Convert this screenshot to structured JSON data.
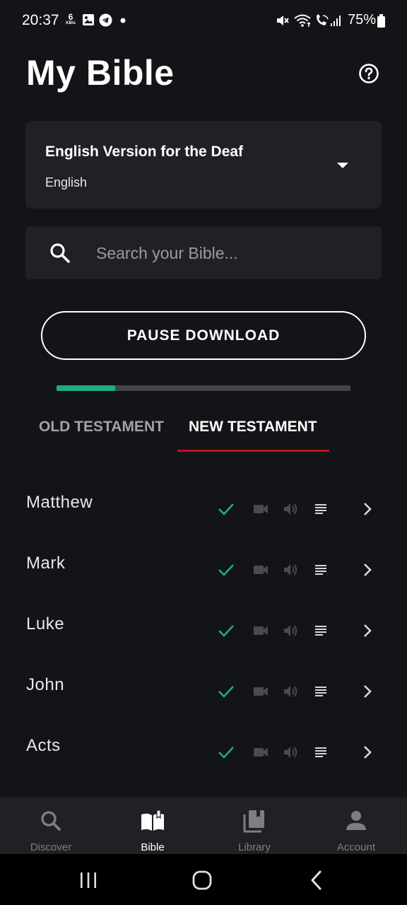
{
  "status_bar": {
    "time": "20:37",
    "net_speed_value": "6",
    "net_speed_unit": "KB/s",
    "battery": "75%",
    "icons": [
      "image-icon",
      "telegram-icon",
      "dot-icon",
      "mute-icon",
      "wifi-icon",
      "wifi-calling-icon",
      "signal-icon",
      "battery-icon"
    ]
  },
  "header": {
    "title": "My Bible",
    "help_icon": "help-circle-icon"
  },
  "version": {
    "name": "English Version for the Deaf",
    "language": "English",
    "dropdown_icon": "caret-down-icon"
  },
  "search": {
    "placeholder": "Search your Bible...",
    "value": ""
  },
  "download": {
    "button_label": "PAUSE DOWNLOAD",
    "progress_fraction": 0.2
  },
  "tabs": {
    "items": [
      "OLD TESTAMENT",
      "NEW TESTAMENT"
    ],
    "selected": "NEW TESTAMENT"
  },
  "books": [
    {
      "name": "Matthew",
      "downloaded": true,
      "video": false,
      "audio": false,
      "text": true
    },
    {
      "name": "Mark",
      "downloaded": true,
      "video": false,
      "audio": false,
      "text": true
    },
    {
      "name": "Luke",
      "downloaded": true,
      "video": false,
      "audio": false,
      "text": true
    },
    {
      "name": "John",
      "downloaded": true,
      "video": false,
      "audio": false,
      "text": true
    },
    {
      "name": "Acts",
      "downloaded": true,
      "video": false,
      "audio": false,
      "text": true
    }
  ],
  "bottom_nav": {
    "items": [
      {
        "label": "Discover",
        "icon": "search-icon",
        "active": false
      },
      {
        "label": "Bible",
        "icon": "open-book-icon",
        "active": true
      },
      {
        "label": "Library",
        "icon": "library-icon",
        "active": false
      },
      {
        "label": "Account",
        "icon": "person-icon",
        "active": false
      }
    ]
  },
  "colors": {
    "background": "#131417",
    "card": "#202125",
    "accent_green": "#1eaa84",
    "tab_underline": "#c1121c",
    "muted_icon": "#4a4b50"
  }
}
